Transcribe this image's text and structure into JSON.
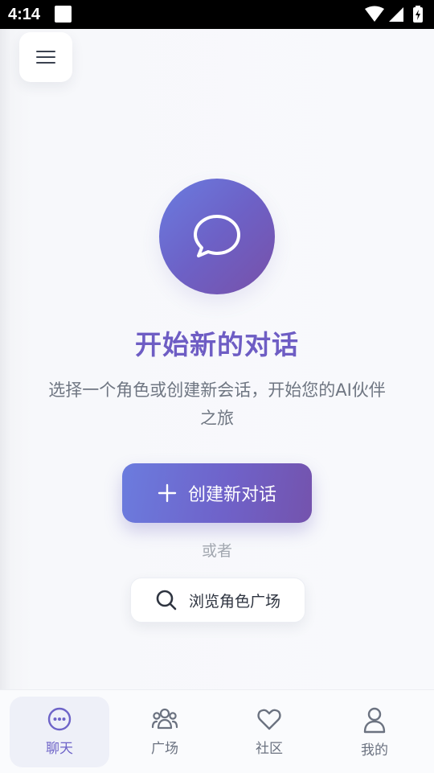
{
  "status_bar": {
    "time": "4:14",
    "icons": [
      "notification-square-icon",
      "wifi-icon",
      "signal-icon",
      "battery-charging-icon"
    ]
  },
  "menu": {
    "icon": "hamburger-menu-icon"
  },
  "hero": {
    "icon": "chat-bubble-icon",
    "gradient": [
      "#6a7ce0",
      "#7850a8"
    ]
  },
  "title": "开始新的对话",
  "subtitle": "选择一个角色或创建新会话，开始您的AI伙伴之旅",
  "create_button": {
    "icon": "plus-icon",
    "label": "创建新对话"
  },
  "or_text": "或者",
  "browse_button": {
    "icon": "search-icon",
    "label": "浏览角色广场"
  },
  "bottom_nav": {
    "items": [
      {
        "label": "聊天",
        "icon": "chat-dots-icon",
        "active": true
      },
      {
        "label": "广场",
        "icon": "people-group-icon",
        "active": false
      },
      {
        "label": "社区",
        "icon": "heart-icon",
        "active": false
      },
      {
        "label": "我的",
        "icon": "user-icon",
        "active": false
      }
    ]
  },
  "colors": {
    "accent": "#6e5dc4",
    "accent_active_nav": "#6e64c8",
    "muted_text": "#6f7682",
    "nav_inactive": "#6b7280"
  }
}
